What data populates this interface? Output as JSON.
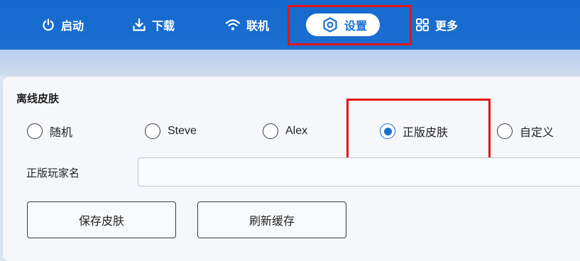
{
  "nav": {
    "items": [
      {
        "label": "启动",
        "icon": "power-icon"
      },
      {
        "label": "下载",
        "icon": "download-icon"
      },
      {
        "label": "联机",
        "icon": "wifi-icon"
      },
      {
        "label": "设置",
        "icon": "settings-icon",
        "active": true
      },
      {
        "label": "更多",
        "icon": "grid-icon"
      }
    ]
  },
  "colors": {
    "accent": "#1a6fd1",
    "highlight": "#e41414"
  },
  "skin": {
    "section_title": "离线皮肤",
    "options": [
      {
        "label": "随机",
        "checked": false
      },
      {
        "label": "Steve",
        "checked": false
      },
      {
        "label": "Alex",
        "checked": false
      },
      {
        "label": "正版皮肤",
        "checked": true
      },
      {
        "label": "自定义",
        "checked": false
      }
    ],
    "player_name_label": "正版玩家名",
    "player_name_value": "",
    "save_button": "保存皮肤",
    "refresh_button": "刷新缓存"
  }
}
